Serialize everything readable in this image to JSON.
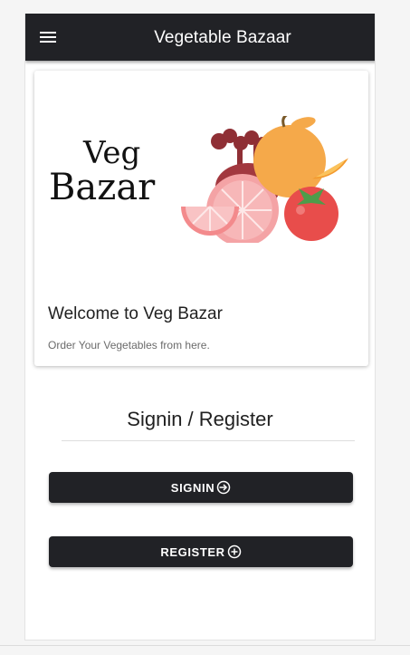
{
  "app": {
    "title": "Vegetable Bazaar"
  },
  "card": {
    "logo_line1": "Veg",
    "logo_line2": "Bazar",
    "title": "Welcome to Veg Bazar",
    "subtitle": "Order Your Vegetables from here."
  },
  "auth": {
    "heading": "Signin / Register",
    "signin_label": "SIGNIN",
    "register_label": "REGISTER"
  },
  "icons": {
    "menu": "menu-icon",
    "signin": "login-icon",
    "register": "add-circle-icon"
  },
  "colors": {
    "toolbar": "#212226",
    "button": "#212226",
    "beet": "#a2383f",
    "orange": "#f5a94a",
    "grapefruit": "#f4a3a5",
    "tomato": "#e84d4b"
  }
}
